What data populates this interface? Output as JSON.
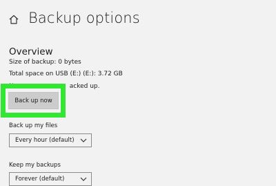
{
  "header": {
    "title": "Backup options",
    "home_icon": "home-icon"
  },
  "overview": {
    "heading": "Overview",
    "size_of_backup": "Size of backup: 0 bytes",
    "total_space": "Total space on USB (E:) (E:): 3.72 GB",
    "status_visible_fragment": "N...acked up.",
    "back_up_now_label": "Back up now",
    "highlight_color": "#33e633"
  },
  "backup_frequency": {
    "label": "Back up my files",
    "selected": "Every hour (default)"
  },
  "retention": {
    "label": "Keep my backups",
    "selected": "Forever (default)"
  }
}
